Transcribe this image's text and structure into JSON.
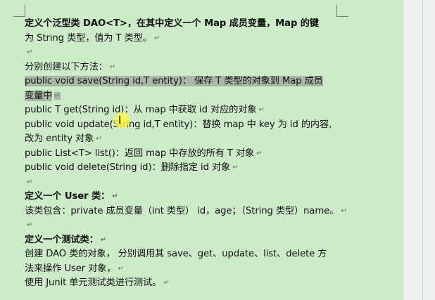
{
  "document": {
    "section1": {
      "title": "定义个泛型类 DAO<T>，在其中定义一个 Map 成员变量，Map 的键",
      "title_cont": "为 String 类型，值为 T 类型。"
    },
    "methods": {
      "intro": "分别创建以下方法：",
      "save_line1": "public void save(String id,T entity)：  保存 T 类型的对象到 Map 成员",
      "save_line2": "变量中",
      "get": "public T get(String id)：从 map 中获取 id 对应的对象",
      "update_line1": "public void update(String id,T entity)：替换 map 中 key 为 id 的内容,",
      "update_line2": "改为 entity 对象",
      "list": "public List<T> list()：返回 map 中存放的所有 T 对象",
      "delete": "public void delete(String id)：删除指定 id 对象"
    },
    "section2": {
      "title": "定义一个 User 类：",
      "desc": "该类包含：private 成员变量（int 类型） id，age；（String 类型）name。"
    },
    "section3": {
      "title": "定义一个测试类：",
      "line1": "创建 DAO 类的对象， 分别调用其 save、get、update、list、delete 方",
      "line2": "法来操作 User 对象，",
      "line3": "使用 Junit 单元测试类进行测试。"
    },
    "paragraph_mark": "↵",
    "cursor_icon": "text-cursor-icon",
    "highlight_color": "#a9b8a7",
    "page_color": "#cdebc9"
  }
}
